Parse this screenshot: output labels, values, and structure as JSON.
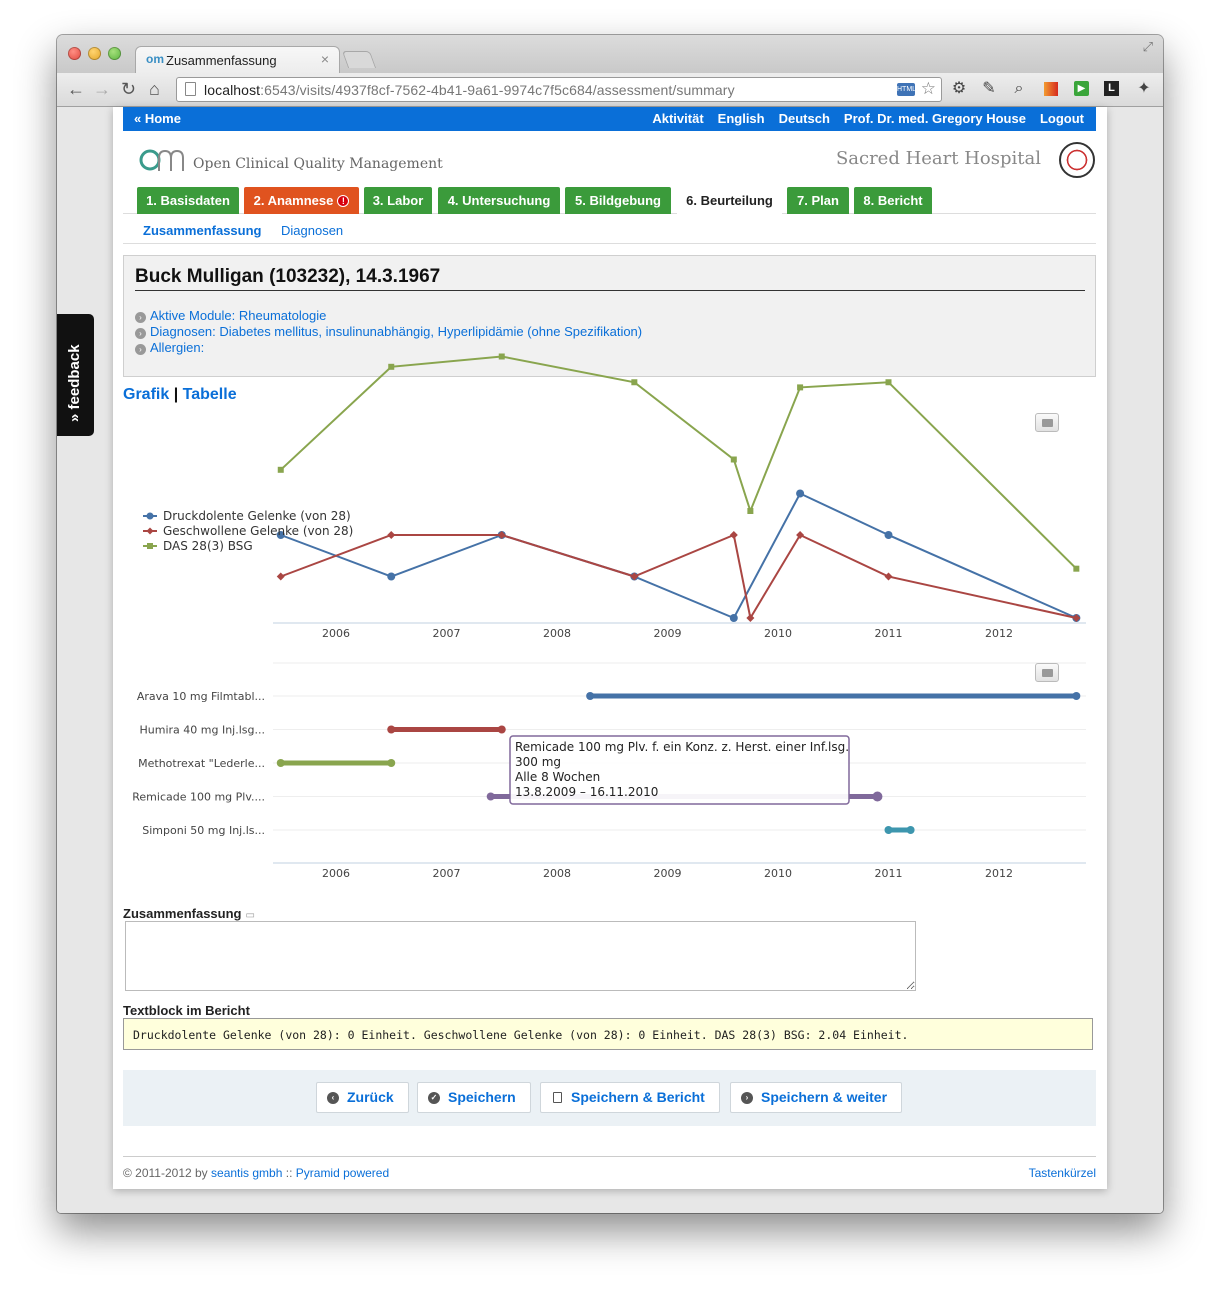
{
  "browser": {
    "tab_title": "Zusammenfassung",
    "tab_favicon": "om",
    "url_host": "localhost",
    "url_path": ":6543/visits/4937f8cf-7562-4b41-9a61-9974c7f5c684/assessment/summary",
    "html5_badge": "HTML",
    "icons": [
      "back-icon",
      "forward-icon",
      "reload-icon",
      "home-icon",
      "page-icon",
      "star-icon",
      "gear-icon",
      "wrench-icon",
      "magnifier-icon",
      "red-extension-icon",
      "play-extension-icon",
      "l-extension-icon",
      "settings-wrench-icon"
    ]
  },
  "feedback_tab": "» feedback",
  "topbar": {
    "home": "« Home",
    "links": [
      "Aktivität",
      "English",
      "Deutsch",
      "Prof. Dr. med. Gregory House",
      "Logout"
    ]
  },
  "brand": {
    "app_name": "Open Clinical Quality Management",
    "hospital": "Sacred Heart Hospital"
  },
  "tabs": [
    {
      "label": "1. Basisdaten",
      "state": "green"
    },
    {
      "label": "2. Anamnese",
      "state": "orange",
      "badge": "!"
    },
    {
      "label": "3. Labor",
      "state": "green"
    },
    {
      "label": "4. Untersuchung",
      "state": "green"
    },
    {
      "label": "5. Bildgebung",
      "state": "green"
    },
    {
      "label": "6. Beurteilung",
      "state": "active"
    },
    {
      "label": "7. Plan",
      "state": "green"
    },
    {
      "label": "8. Bericht",
      "state": "green"
    }
  ],
  "subtabs": [
    "Zusammenfassung",
    "Diagnosen"
  ],
  "patient": {
    "title": "Buck Mulligan (103232), 14.3.1967",
    "info": [
      "Aktive Module: Rheumatologie",
      "Diagnosen: Diabetes mellitus, insulinunabhängig, Hyperlipidämie (ohne Spezifikation)",
      "Allergien:"
    ]
  },
  "view_switch": {
    "grafik": "Grafik",
    "separator": "|",
    "tabelle": "Tabelle"
  },
  "chart_data": [
    {
      "type": "line",
      "x_axis": [
        "2006",
        "2007",
        "2008",
        "2009",
        "2010",
        "2011",
        "2012"
      ],
      "legend": "left",
      "series": [
        {
          "name": "Druckdolente Gelenke (von 28)",
          "color": "#4572a7",
          "marker": "circle",
          "x": [
            "2005.5",
            "2006.5",
            "2007.5",
            "2008.7",
            "2009.6",
            "2010.2",
            "2011.0",
            "2012.7"
          ],
          "y": [
            2,
            1,
            2,
            1,
            0,
            3,
            2,
            0
          ]
        },
        {
          "name": "Geschwollene Gelenke (von 28)",
          "color": "#aa4643",
          "marker": "diamond",
          "x": [
            "2005.5",
            "2006.5",
            "2007.5",
            "2008.7",
            "2009.6",
            "2009.75",
            "2010.2",
            "2011.0",
            "2012.7"
          ],
          "y": [
            1,
            2,
            2,
            1,
            2,
            0,
            2,
            1,
            0
          ]
        },
        {
          "name": "DAS 28(3) BSG",
          "color": "#89a54e",
          "marker": "square",
          "x": [
            "2005.5",
            "2006.5",
            "2007.5",
            "2008.7",
            "2009.6",
            "2009.75",
            "2010.2",
            "2011.0",
            "2012.7"
          ],
          "y": [
            3.0,
            4.0,
            4.1,
            3.85,
            3.1,
            2.6,
            3.8,
            3.85,
            2.04
          ]
        }
      ]
    },
    {
      "type": "gantt",
      "x_axis": [
        "2006",
        "2007",
        "2008",
        "2009",
        "2010",
        "2011",
        "2012"
      ],
      "categories": [
        "Arava 10 mg Filmtabl...",
        "Humira 40 mg Inj.lsg...",
        "Methotrexat \"Lederle...",
        "Remicade 100 mg Plv....",
        "Simponi 50 mg Inj.ls..."
      ],
      "series": [
        {
          "name": "Arava 10 mg Filmtabl...",
          "color": "#4572a7",
          "start": 2008.3,
          "end": 2012.7
        },
        {
          "name": "Humira 40 mg Inj.lsg...",
          "color": "#aa4643",
          "start": 2006.5,
          "end": 2007.5
        },
        {
          "name": "Methotrexat \"Lederle...",
          "color": "#89a54e",
          "start": 2005.5,
          "end": 2006.5
        },
        {
          "name": "Remicade 100 mg Plv....",
          "color": "#80699b",
          "start": 2007.4,
          "end": 2010.9
        },
        {
          "name": "Simponi 50 mg Inj.ls...",
          "color": "#3d96ae",
          "start": 2011.0,
          "end": 2011.2
        }
      ],
      "tooltip": [
        "Remicade 100 mg Plv. f. ein Konz. z. Herst. einer Inf.lsg.",
        "300 mg",
        "Alle 8 Wochen",
        "13.8.2009 – 16.11.2010"
      ]
    }
  ],
  "summary": {
    "label": "Zusammenfassung",
    "value": ""
  },
  "textblock": {
    "label": "Textblock im Bericht",
    "value": "Druckdolente Gelenke (von 28): 0 Einheit. Geschwollene Gelenke (von 28): 0 Einheit. DAS 28(3) BSG: 2.04 Einheit."
  },
  "buttons": [
    "Zurück",
    "Speichern",
    "Speichern & Bericht",
    "Speichern & weiter"
  ],
  "footer": {
    "copyright": "© 2011-2012 by",
    "company": "seantis gmbh",
    "sep": "::",
    "powered": "Pyramid powered",
    "shortcuts": "Tastenkürzel"
  }
}
